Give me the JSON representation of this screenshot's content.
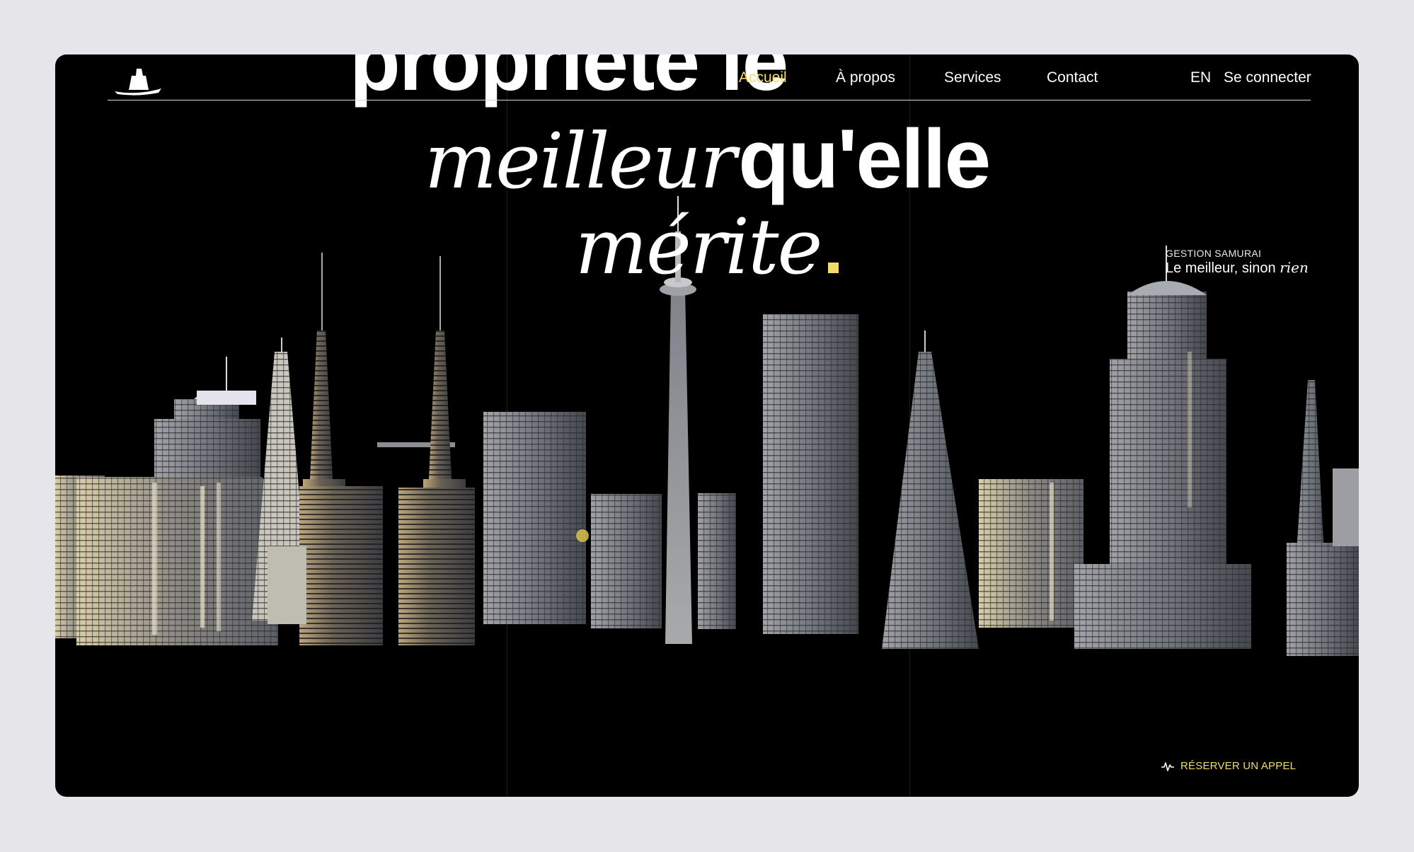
{
  "hero": {
    "line1": "propriété le",
    "line2_italic": "meilleur",
    "line2_bold": "qu'elle",
    "line3_italic": "mérite"
  },
  "nav": {
    "items": [
      {
        "label": "Accueil",
        "active": true
      },
      {
        "label": "À propos",
        "active": false
      },
      {
        "label": "Services",
        "active": false
      },
      {
        "label": "Contact",
        "active": false
      }
    ],
    "language": "EN",
    "login": "Se connecter"
  },
  "tagline": {
    "brand": "GESTION SAMURAI",
    "text": "Le meilleur, sinon",
    "emphasis": "rien"
  },
  "cta": {
    "label": "RÉSERVER UN APPEL",
    "icon": "pulse-icon"
  },
  "colors": {
    "accent": "#f4dc6a",
    "background": "#000000",
    "page": "#e6e6ea"
  }
}
